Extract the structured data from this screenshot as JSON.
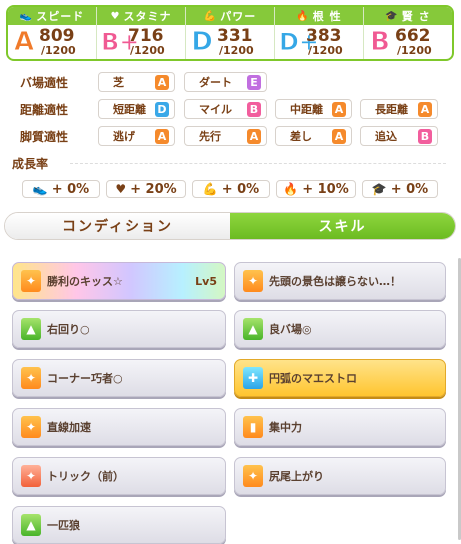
{
  "stats": [
    {
      "icon": "shoe-icon",
      "icon_glyph": "👟",
      "label": "スピード",
      "rank": "A",
      "value": "809",
      "max": "/1200"
    },
    {
      "icon": "heart-icon",
      "icon_glyph": "♥",
      "label": "スタミナ",
      "rank": "B+",
      "value": "716",
      "max": "/1200"
    },
    {
      "icon": "muscle-icon",
      "icon_glyph": "💪",
      "label": "パワー",
      "rank": "D",
      "value": "331",
      "max": "/1200"
    },
    {
      "icon": "flame-icon",
      "icon_glyph": "🔥",
      "label": "根 性",
      "rank": "D+",
      "value": "383",
      "max": "/1200"
    },
    {
      "icon": "cap-icon",
      "icon_glyph": "🎓",
      "label": "賢 さ",
      "rank": "B",
      "value": "662",
      "max": "/1200"
    }
  ],
  "aptitude": {
    "track": {
      "title": "バ場適性",
      "items": [
        {
          "label": "芝",
          "grade": "A"
        },
        {
          "label": "ダート",
          "grade": "E"
        }
      ]
    },
    "distance": {
      "title": "距離適性",
      "items": [
        {
          "label": "短距離",
          "grade": "D"
        },
        {
          "label": "マイル",
          "grade": "B"
        },
        {
          "label": "中距離",
          "grade": "A"
        },
        {
          "label": "長距離",
          "grade": "A"
        }
      ]
    },
    "style": {
      "title": "脚質適性",
      "items": [
        {
          "label": "逃げ",
          "grade": "A"
        },
        {
          "label": "先行",
          "grade": "A"
        },
        {
          "label": "差し",
          "grade": "A"
        },
        {
          "label": "追込",
          "grade": "B"
        }
      ]
    }
  },
  "growth": {
    "title": "成長率",
    "items": [
      {
        "icon": "shoe-icon",
        "glyph": "👟",
        "value": "+ 0%"
      },
      {
        "icon": "heart-icon",
        "glyph": "♥",
        "value": "+ 20%"
      },
      {
        "icon": "muscle-icon",
        "glyph": "💪",
        "value": "+ 0%"
      },
      {
        "icon": "flame-icon",
        "glyph": "🔥",
        "value": "+ 10%"
      },
      {
        "icon": "cap-icon",
        "glyph": "🎓",
        "value": "+ 0%"
      }
    ]
  },
  "tabs": {
    "condition": "コンディション",
    "skill": "スキル",
    "active": "skill"
  },
  "skills": [
    {
      "name": "勝利のキッス☆",
      "level": "Lv5",
      "style": "unique",
      "icon": "orange"
    },
    {
      "name": "先頭の景色は譲らない…！",
      "level": "",
      "style": "normal",
      "icon": "orange"
    },
    {
      "name": "右回り○",
      "level": "",
      "style": "normal",
      "icon": "green"
    },
    {
      "name": "良バ場◎",
      "level": "",
      "style": "normal",
      "icon": "green"
    },
    {
      "name": "コーナー巧者○",
      "level": "",
      "style": "normal",
      "icon": "orange"
    },
    {
      "name": "円弧のマエストロ",
      "level": "",
      "style": "gold",
      "icon": "blue"
    },
    {
      "name": "直線加速",
      "level": "",
      "style": "normal",
      "icon": "orange"
    },
    {
      "name": "集中力",
      "level": "",
      "style": "normal",
      "icon": "orange"
    },
    {
      "name": "トリック（前）",
      "level": "",
      "style": "normal",
      "icon": "red"
    },
    {
      "name": "尻尾上がり",
      "level": "",
      "style": "normal",
      "icon": "orange"
    },
    {
      "name": "一匹狼",
      "level": "",
      "style": "normal",
      "icon": "green"
    }
  ],
  "colors": {
    "accent": "#86c93a",
    "text": "#794016",
    "grade_A": "#f58a2c",
    "grade_B": "#f25e9d",
    "grade_D": "#3aa8e8",
    "grade_E": "#c16fe0"
  }
}
